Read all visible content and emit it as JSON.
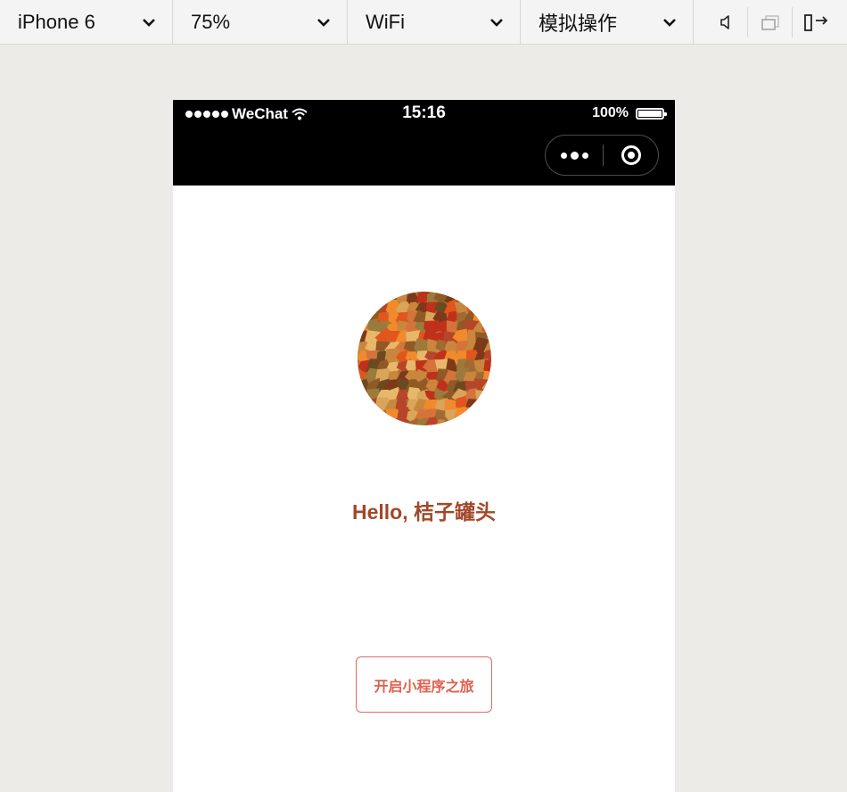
{
  "toolbar": {
    "device": "iPhone 6",
    "zoom": "75%",
    "network": "WiFi",
    "operation": "模拟操作",
    "icons": [
      "speaker-icon",
      "window-icon",
      "dock-right-icon"
    ]
  },
  "statusbar": {
    "carrier": "WeChat",
    "time": "15:16",
    "battery": "100%"
  },
  "page": {
    "greeting": "Hello, 桔子罐头",
    "start_button": "开启小程序之旅"
  },
  "colors": {
    "greeting": "#a2482a",
    "button_text": "#e0614e",
    "button_border": "#e06b5f",
    "background": "#ecebe8"
  }
}
